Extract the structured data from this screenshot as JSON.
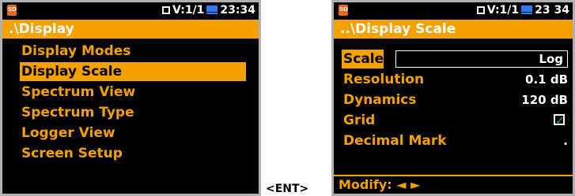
{
  "status": {
    "memory": "V:1/1",
    "time": "23:34"
  },
  "status_right": {
    "memory": "V:1/1",
    "time": "23 34"
  },
  "left": {
    "title": ".\\Display",
    "items": [
      {
        "label": "Display Modes",
        "selected": false
      },
      {
        "label": "Display Scale",
        "selected": true
      },
      {
        "label": "Spectrum View",
        "selected": false
      },
      {
        "label": "Spectrum Type",
        "selected": false
      },
      {
        "label": "Logger View",
        "selected": false
      },
      {
        "label": "Screen Setup",
        "selected": false
      }
    ]
  },
  "right": {
    "title": "..\\Display Scale",
    "params": [
      {
        "label": "Scale",
        "value": "Log",
        "selected": true
      },
      {
        "label": "Resolution",
        "value": "0.1 dB",
        "selected": false
      },
      {
        "label": "Dynamics",
        "value": "120 dB",
        "selected": false
      },
      {
        "label": "Grid",
        "value": "",
        "checked": true,
        "selected": false
      },
      {
        "label": "Decimal Mark",
        "value": ".",
        "selected": false
      }
    ],
    "footer": "Modify: ◄ ►"
  },
  "enter_label": "<ENT>",
  "colors": {
    "accent": "#f4a100",
    "battery": "#2b7df7",
    "check": "#2ec52e"
  }
}
